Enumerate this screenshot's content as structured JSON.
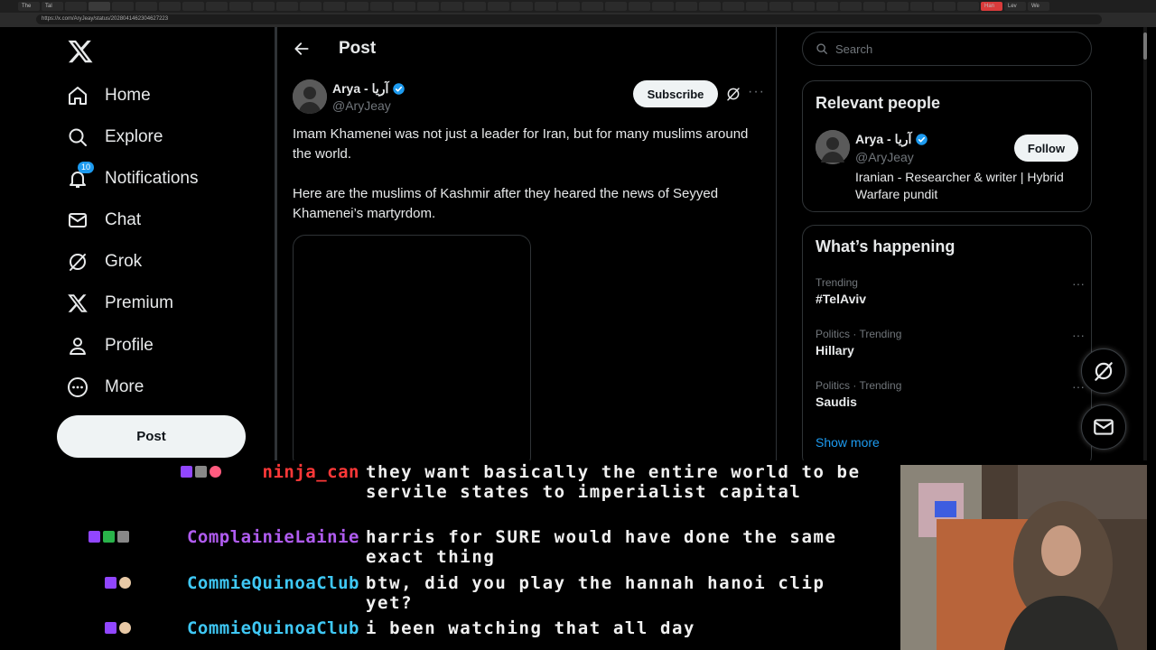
{
  "browser": {
    "tabs": [
      "The",
      "Tal",
      "",
      "",
      "",
      "",
      "",
      "",
      "",
      "",
      "",
      "",
      "",
      "",
      "",
      "",
      "",
      "",
      "",
      "",
      "",
      "",
      "",
      "",
      "",
      "",
      "",
      "",
      "",
      "",
      "",
      "",
      "",
      "",
      "",
      "",
      "",
      "",
      "",
      "",
      "",
      "Han",
      "Lev",
      "We"
    ],
    "url": "https://x.com/AryJeay/status/2028041462304627223"
  },
  "sidebar": {
    "items": [
      {
        "label": "Home",
        "icon": "home-icon"
      },
      {
        "label": "Explore",
        "icon": "search-icon"
      },
      {
        "label": "Notifications",
        "icon": "bell-icon",
        "badge": "10"
      },
      {
        "label": "Chat",
        "icon": "mail-icon"
      },
      {
        "label": "Grok",
        "icon": "grok-icon"
      },
      {
        "label": "Premium",
        "icon": "x-logo-icon"
      },
      {
        "label": "Profile",
        "icon": "person-icon"
      },
      {
        "label": "More",
        "icon": "more-circle-icon"
      }
    ],
    "post_label": "Post"
  },
  "main": {
    "title": "Post",
    "author_name": "Arya - آریا",
    "author_handle": "@AryJeay",
    "subscribe_label": "Subscribe",
    "more_label": "···",
    "text_p1": "Imam Khamenei was not just a leader for Iran, but for many muslims around the world.",
    "text_p2": "Here are the muslims of Kashmir after they heared the news of Seyyed Khamenei’s martyrdom."
  },
  "right": {
    "search_placeholder": "Search",
    "relevant_title": "Relevant people",
    "person_name": "Arya - آریا",
    "person_handle": "@AryJeay",
    "person_bio": "Iranian - Researcher & writer | Hybrid Warfare pundit",
    "follow_label": "Follow",
    "happening_title": "What’s happening",
    "trends": [
      {
        "meta": "Trending",
        "name": "#TelAviv"
      },
      {
        "meta": "Politics · Trending",
        "name": "Hillary"
      },
      {
        "meta": "Politics · Trending",
        "name": "Saudis"
      }
    ],
    "show_more": "Show more"
  },
  "chat": {
    "lines": [
      {
        "user": "ninja_can",
        "color": "#ff3838",
        "msg": "they want basically the entire world to be servile states to imperialist capital"
      },
      {
        "user": "ComplainieLainie",
        "color": "#b05cf0",
        "msg": "harris for SURE would have done the same exact thing"
      },
      {
        "user": "CommieQuinoaClub",
        "color": "#3fc8f5",
        "msg": "btw, did you play the hannah hanoi clip yet?"
      },
      {
        "user": "CommieQuinoaClub",
        "color": "#3fc8f5",
        "msg": "i been watching that all day"
      }
    ]
  },
  "colors": {
    "accent": "#1d9bf0",
    "border": "#2f3336",
    "muted": "#71767b",
    "text": "#e7e9ea"
  }
}
